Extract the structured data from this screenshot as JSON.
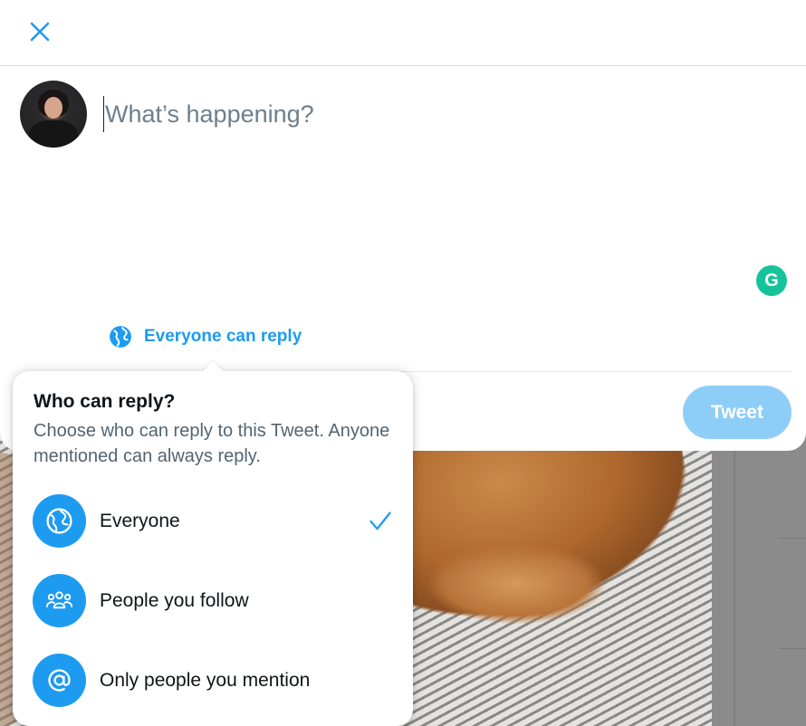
{
  "compose": {
    "placeholder": "What’s happening?",
    "reply_setting_label": "Everyone can reply",
    "tweet_button_label": "Tweet",
    "grammarly_label": "G"
  },
  "reply_menu": {
    "title": "Who can reply?",
    "description": "Choose who can reply to this Tweet. Anyone mentioned can always reply.",
    "options": [
      {
        "label": "Everyone",
        "icon": "globe-icon",
        "selected": true
      },
      {
        "label": "People you follow",
        "icon": "people-icon",
        "selected": false
      },
      {
        "label": "Only people you mention",
        "icon": "at-icon",
        "selected": false
      }
    ]
  },
  "colors": {
    "accent": "#1d9bf0",
    "tweet_button_disabled": "#8ecdf7",
    "grammarly": "#15c39a"
  }
}
